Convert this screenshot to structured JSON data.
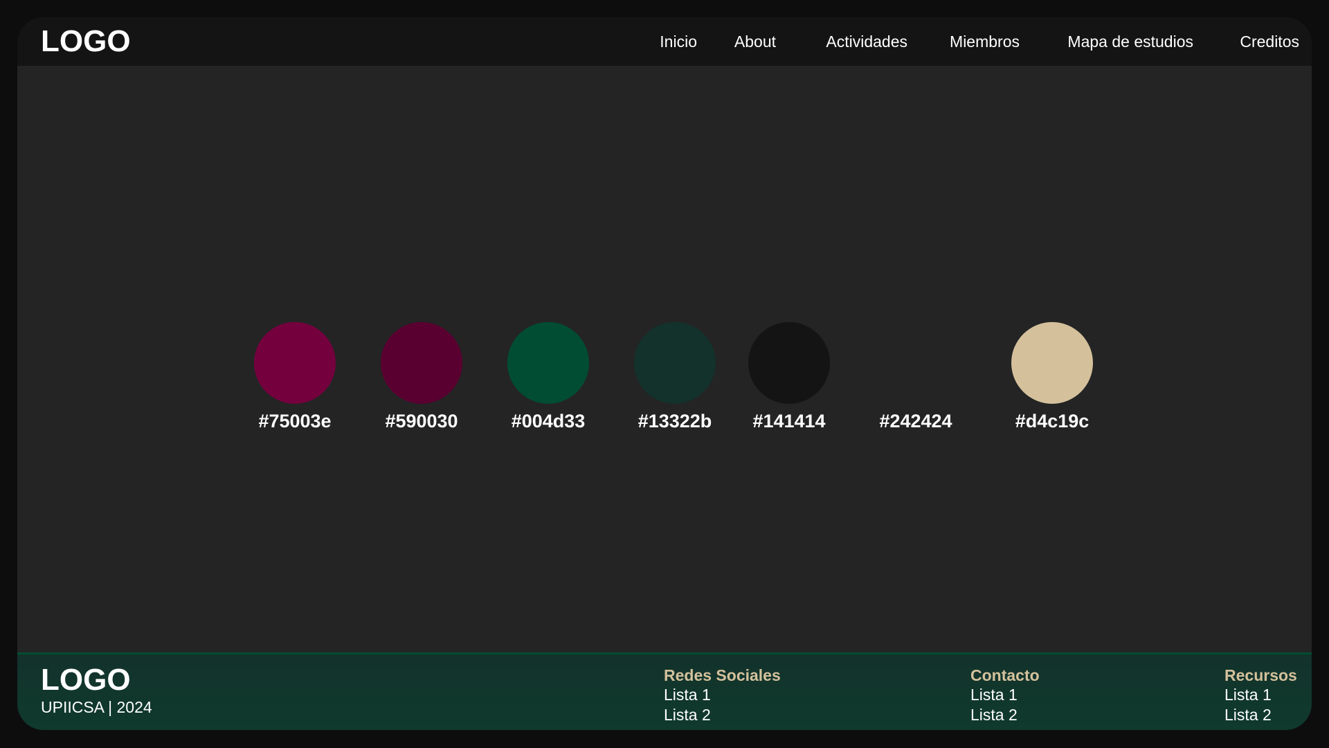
{
  "header": {
    "logo": "LOGO",
    "nav": [
      "Inicio",
      "About",
      "Actividades",
      "Miembros",
      "Mapa de estudios",
      "Creditos"
    ]
  },
  "palette": [
    {
      "color": "#75003e",
      "label": "#75003e"
    },
    {
      "color": "#590030",
      "label": "#590030"
    },
    {
      "color": "#004d33",
      "label": "#004d33"
    },
    {
      "color": "#13322b",
      "label": "#13322b"
    },
    {
      "color": "#141414",
      "label": "#141414"
    },
    {
      "color": "#242424",
      "label": "#242424"
    },
    {
      "color": "#d4c19c",
      "label": "#d4c19c"
    }
  ],
  "footer": {
    "logo": "LOGO",
    "subtitle": "UPIICSA | 2024",
    "columns": [
      {
        "title": "Redes Sociales",
        "items": [
          "Lista 1",
          "Lista 2"
        ]
      },
      {
        "title": "Contacto",
        "items": [
          "Lista 1",
          "Lista 2"
        ]
      },
      {
        "title": "Recursos",
        "items": [
          "Lista 1",
          "Lista 2"
        ]
      }
    ]
  }
}
